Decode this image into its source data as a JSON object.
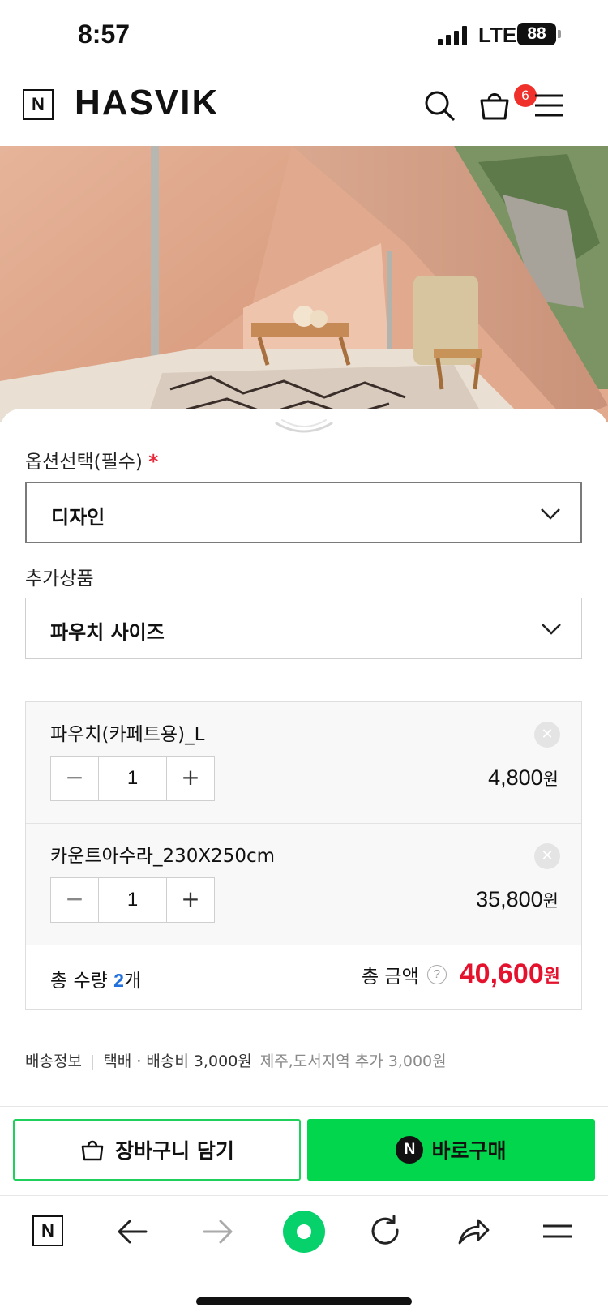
{
  "status_bar": {
    "time": "8:57",
    "network": "LTE",
    "battery": "88"
  },
  "header": {
    "n_logo": "N",
    "brand": "HASVIK",
    "cart_count": "6"
  },
  "option": {
    "label": "옵션선택(필수)",
    "required_mark": "*",
    "selected": "디자인"
  },
  "addon": {
    "label": "추가상품",
    "selected": "파우치 사이즈"
  },
  "items": [
    {
      "name": "파우치(카페트용)_L",
      "qty": "1",
      "price": "4,800",
      "currency": "원"
    },
    {
      "name": "카운트아수라_230X250cm",
      "qty": "1",
      "price": "35,800",
      "currency": "원"
    }
  ],
  "stepper": {
    "minus": "−",
    "plus": "+"
  },
  "remove_glyph": "✕",
  "total": {
    "qty_prefix": "총 수량",
    "qty_value": "2",
    "qty_suffix": "개",
    "amount_label": "총 금액",
    "help_glyph": "?",
    "amount": "40,600",
    "currency": "원"
  },
  "shipping": {
    "label": "배송정보",
    "separator": "|",
    "method": "택배 · 배송비 3,000원",
    "extra": "제주,도서지역 추가 3,000원"
  },
  "buttons": {
    "cart": "장바구니 담기",
    "buy": "바로구매",
    "buy_badge": "N"
  },
  "browser_bar": {
    "n_logo": "N"
  },
  "colors": {
    "naver_green": "#02d64d",
    "price_red": "#e5122e",
    "badge_red": "#f0302b",
    "qty_blue": "#1f6fdd"
  }
}
